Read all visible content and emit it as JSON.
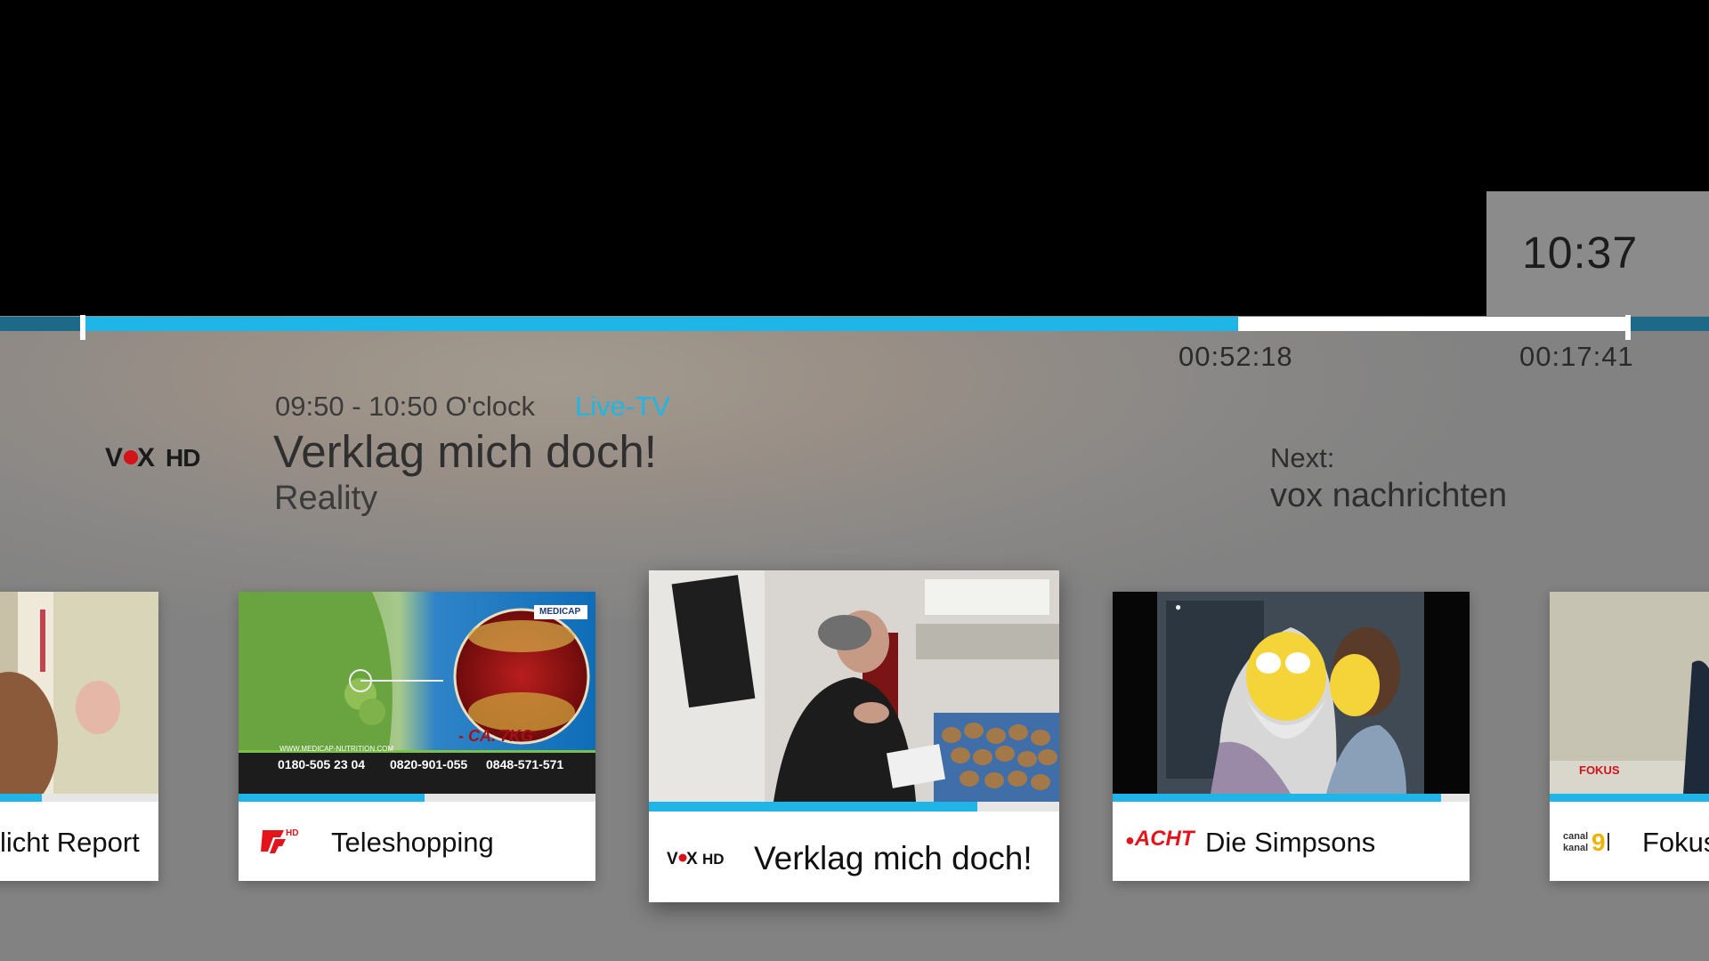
{
  "player": {
    "clock": "10:37",
    "elapsed": "00:52:18",
    "remaining": "00:17:41",
    "progress_fraction": 0.747
  },
  "now_playing": {
    "channel_logo_text": "VOX HD",
    "time_slot": "09:50 - 10:50 O'clock",
    "live_label": "Live-TV",
    "title": "Verklag mich doch!",
    "genre": "Reality",
    "next_label": "Next:",
    "next_title": "vox nachrichten"
  },
  "channels": [
    {
      "title": "licht Report",
      "logo": "",
      "progress": 0.45
    },
    {
      "title": "Teleshopping",
      "logo": "HD",
      "progress": 0.52
    },
    {
      "title": "Verklag mich doch!",
      "logo": "VOX HD",
      "progress": 0.8,
      "focused": true
    },
    {
      "title": "Die Simpsons",
      "logo": "ACHT",
      "progress": 0.92
    },
    {
      "title": "Fokus",
      "logo": "canal kanal 9",
      "progress": 0.95
    }
  ],
  "thumb_texts": {
    "teleshopping_site": "WWW.MEDICAP-NUTRITION.COM",
    "teleshopping_phone_de": "0180-505 23 04",
    "teleshopping_phone_at": "0820-901-055",
    "teleshopping_phone_ch": "0848-571-571",
    "teleshopping_weight": "- CA. 7KG",
    "teleshopping_brand": "MEDICAP",
    "fokus_caption": "FOKUS"
  },
  "colors": {
    "accent": "#1fb5e6",
    "panel": "#828282",
    "timeline_dark": "#1d6a88"
  }
}
